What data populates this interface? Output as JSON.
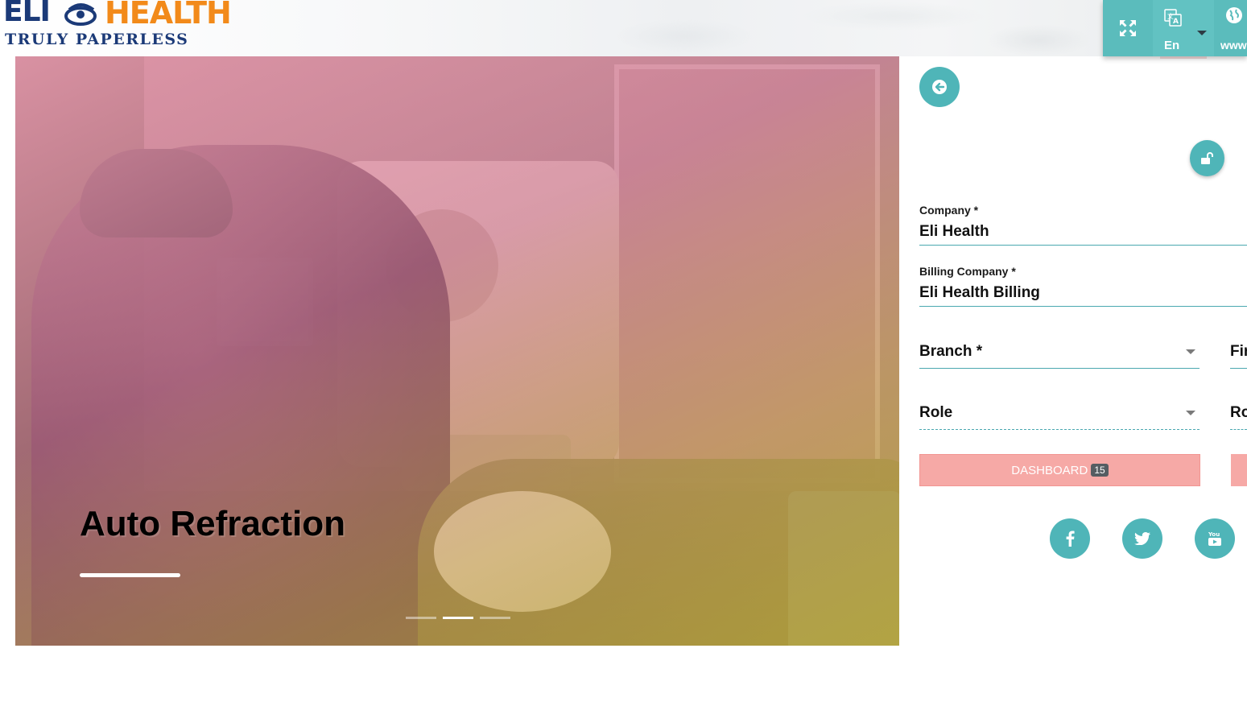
{
  "brand": {
    "name_left": "ELI",
    "name_right": "HEALTH",
    "tagline": "TRULY PAPERLESS"
  },
  "toolbar": {
    "fullscreen_icon": "fullscreen-icon",
    "language_icon": "translate-icon",
    "language": "En",
    "website_icon": "globe-icon",
    "website": "www"
  },
  "slider": {
    "title": "Auto Refraction",
    "indicators": [
      {
        "active": false
      },
      {
        "active": true
      },
      {
        "active": false
      }
    ]
  },
  "form": {
    "company_label": "Company *",
    "company_value": "Eli Health",
    "billing_label": "Billing Company *",
    "billing_value": "Eli Health Billing",
    "branch_placeholder": "Branch *",
    "branch_second_partial": "Fir",
    "role_placeholder": "Role",
    "role_second_partial": "Ro",
    "dashboard_label": "DASHBOARD",
    "dashboard_count": "15"
  },
  "social": {
    "facebook": "facebook-icon",
    "twitter": "twitter-icon",
    "youtube": "youtube-icon"
  },
  "colors": {
    "teal": "#4fb5b8",
    "salmon": "#f6a9a6",
    "brand_blue": "#1b3a78",
    "brand_orange": "#f28a1a"
  }
}
